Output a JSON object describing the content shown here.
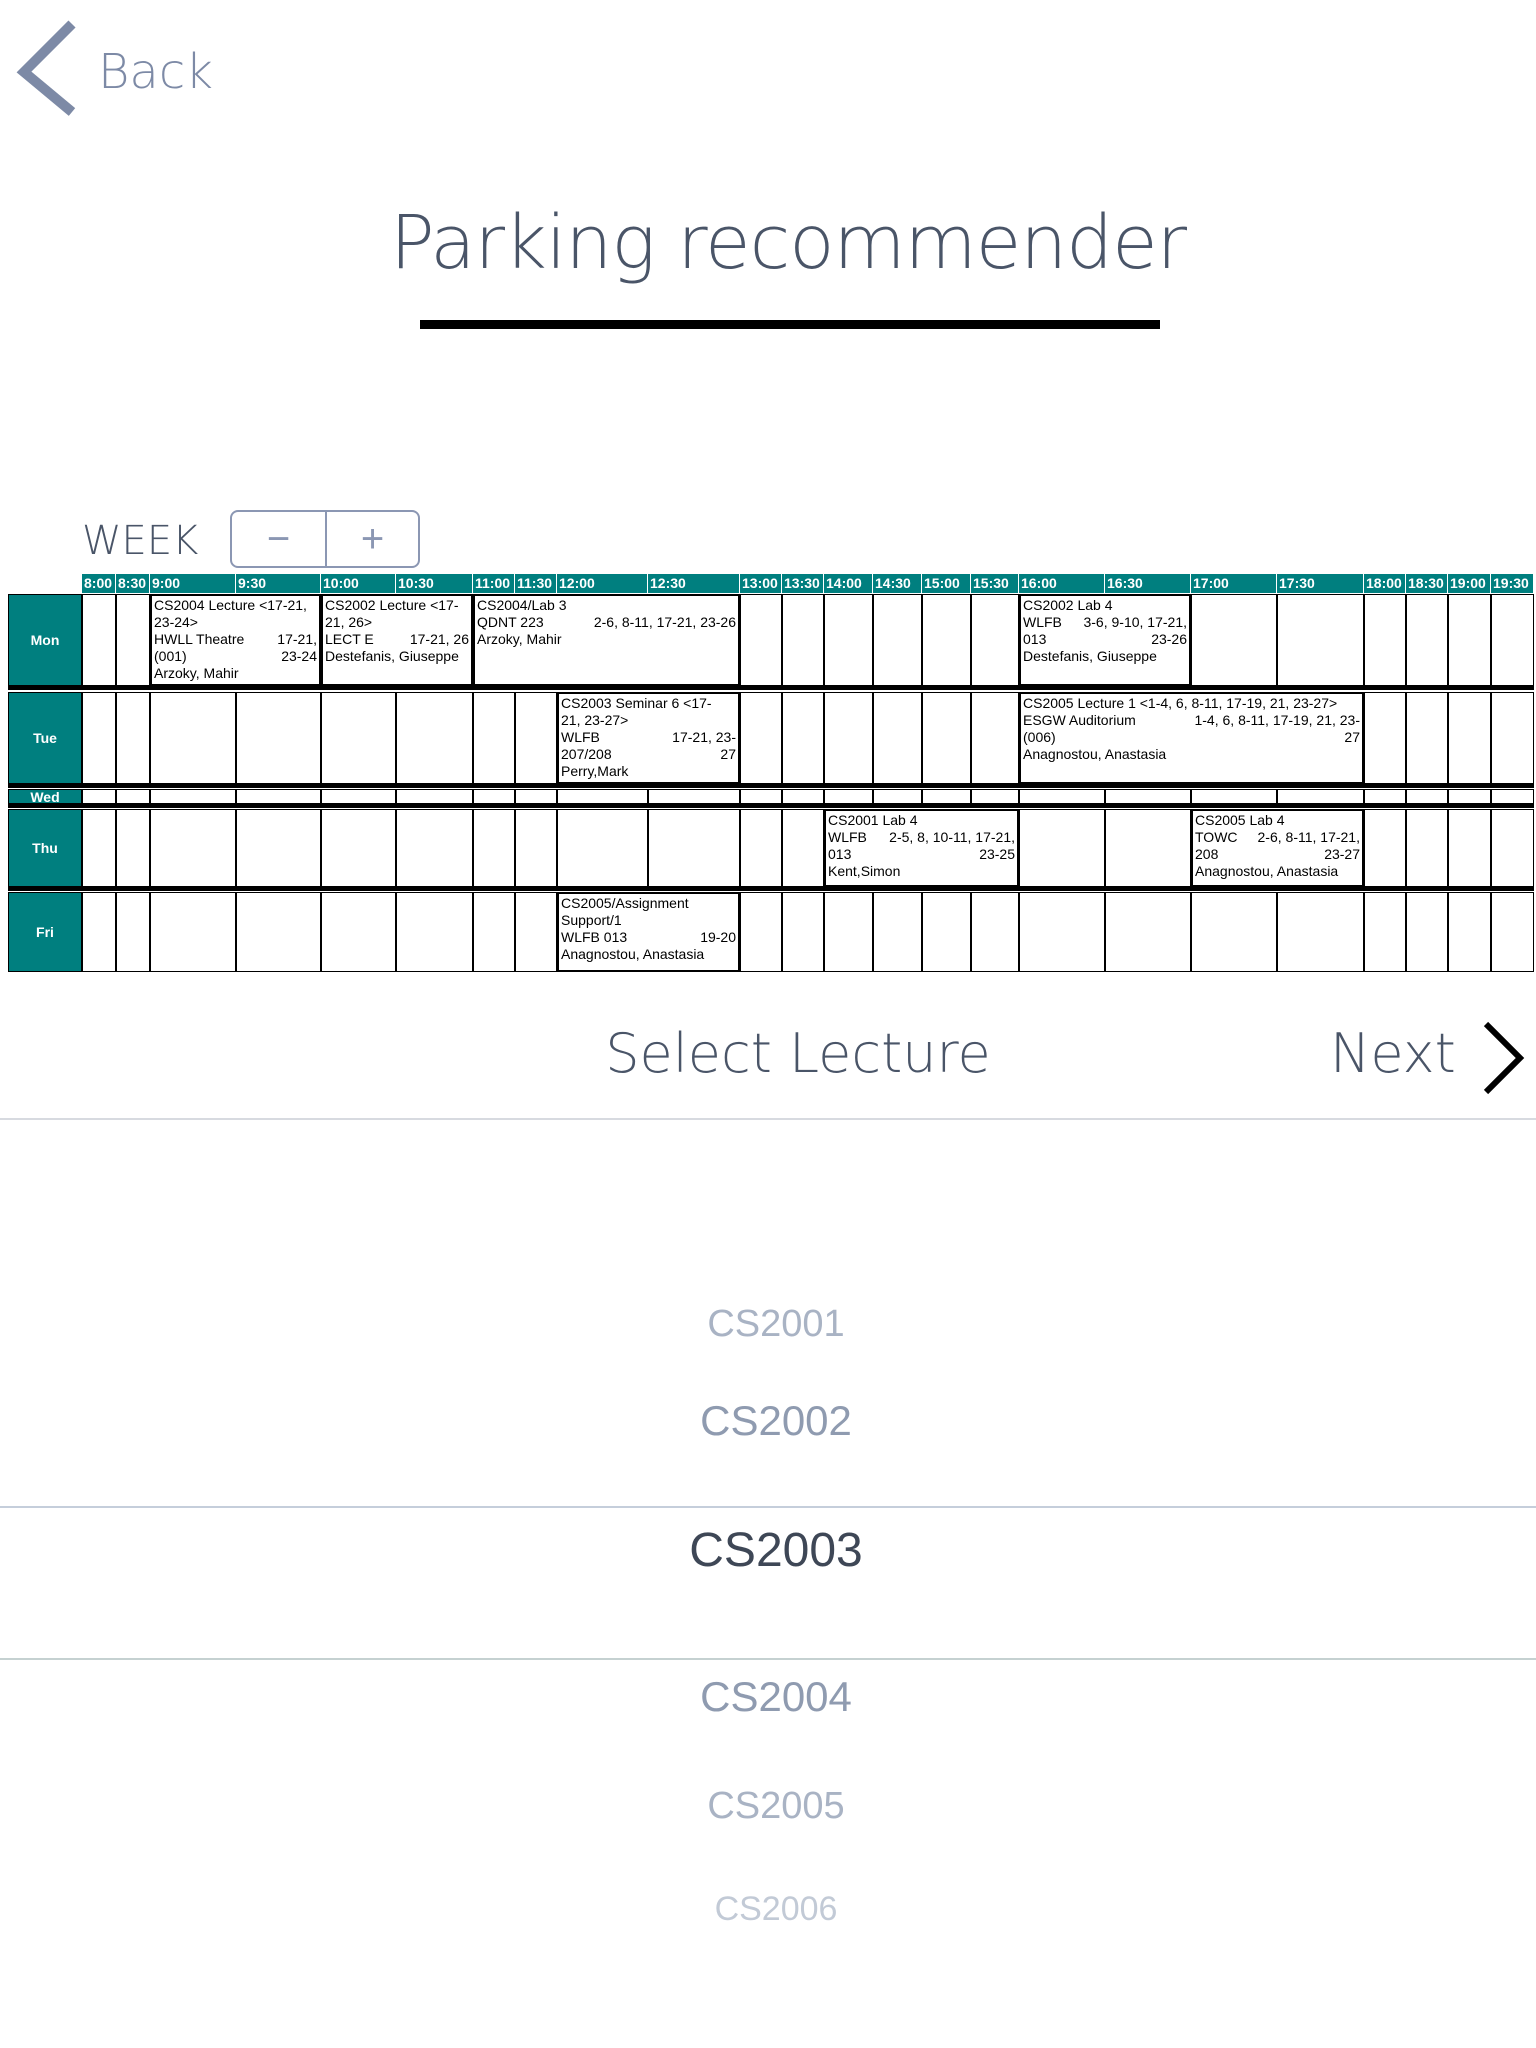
{
  "nav": {
    "back_label": "Back",
    "next_label": "Next"
  },
  "title": "Parking recommender",
  "week": {
    "label": "WEEK",
    "minus": "−",
    "plus": "+"
  },
  "timetable": {
    "times": [
      "8:00",
      "8:30",
      "9:00",
      "9:30",
      "10:00",
      "10:30",
      "11:00",
      "11:30",
      "12:00",
      "12:30",
      "13:00",
      "13:30",
      "14:00",
      "14:30",
      "15:00",
      "15:30",
      "16:00",
      "16:30",
      "17:00",
      "17:30",
      "18:00",
      "18:30",
      "19:00",
      "19:30"
    ],
    "days": [
      "Mon",
      "Tue",
      "Wed",
      "Thu",
      "Fri"
    ],
    "events": [
      {
        "day": "Mon",
        "lines": [
          "CS2004 Lecture <17-21,",
          "23-24>",
          [
            "HWLL Theatre",
            "17-21,"
          ],
          [
            "(001)",
            "23-24"
          ],
          "Arzoky, Mahir"
        ]
      },
      {
        "day": "Mon",
        "lines": [
          "CS2002 Lecture <17-",
          "21, 26>",
          [
            "LECT E",
            "17-21, 26"
          ],
          "Destefanis, Giuseppe"
        ]
      },
      {
        "day": "Mon",
        "lines": [
          "CS2004/Lab 3",
          [
            "QDNT 223",
            "2-6, 8-11, 17-21, 23-26"
          ],
          "Arzoky, Mahir"
        ]
      },
      {
        "day": "Mon",
        "lines": [
          "CS2002 Lab 4",
          [
            "WLFB",
            "3-6, 9-10, 17-21,"
          ],
          [
            "013",
            "23-26"
          ],
          "Destefanis, Giuseppe"
        ]
      },
      {
        "day": "Tue",
        "lines": [
          "CS2003 Seminar 6 <17-",
          "21, 23-27>",
          [
            "WLFB",
            "17-21, 23-"
          ],
          [
            "207/208",
            "27"
          ],
          "Perry,Mark"
        ]
      },
      {
        "day": "Tue",
        "lines": [
          "CS2005 Lecture 1 <1-4, 6, 8-11, 17-19, 21, 23-27>",
          [
            "ESGW Auditorium",
            "1-4, 6, 8-11, 17-19, 21, 23-"
          ],
          [
            "(006)",
            "27"
          ],
          "Anagnostou, Anastasia"
        ]
      },
      {
        "day": "Thu",
        "lines": [
          "CS2001 Lab 4",
          [
            "WLFB",
            "2-5, 8, 10-11, 17-21,"
          ],
          [
            "013",
            "23-25"
          ],
          "Kent,Simon"
        ]
      },
      {
        "day": "Thu",
        "lines": [
          "CS2005 Lab 4",
          [
            "TOWC",
            "2-6, 8-11, 17-21,"
          ],
          [
            "208",
            "23-27"
          ],
          "Anagnostou, Anastasia"
        ]
      },
      {
        "day": "Fri",
        "lines": [
          "CS2005/Assignment",
          "Support/1",
          [
            "WLFB 013",
            "19-20"
          ],
          "Anagnostou, Anastasia"
        ]
      }
    ]
  },
  "picker": {
    "heading": "Select Lecture",
    "options": [
      "CS2001",
      "CS2002",
      "CS2003",
      "CS2004",
      "CS2005",
      "CS2006"
    ],
    "selected": "CS2003"
  }
}
